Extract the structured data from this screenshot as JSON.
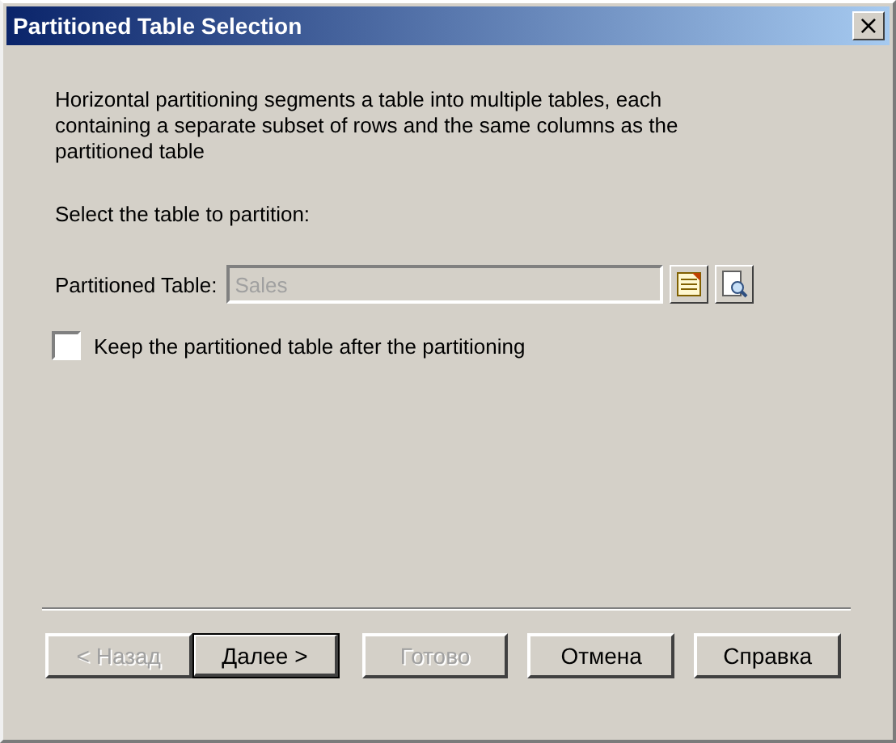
{
  "window": {
    "title": "Partitioned Table Selection",
    "close": "×"
  },
  "description": "Horizontal partitioning segments a table into multiple tables, each containing a separate subset of rows and the same columns as the partitioned table",
  "prompt": "Select the table to partition:",
  "table_field": {
    "label": "Partitioned Table:",
    "value": "Sales",
    "disabled": true
  },
  "keep_checkbox": {
    "label": "Keep the partitioned table after the partitioning",
    "checked": false
  },
  "buttons": [
    {
      "label": "< Назад",
      "disabled": true,
      "default": false
    },
    {
      "label": "Далее >",
      "disabled": false,
      "default": true
    },
    {
      "label": "Готово",
      "disabled": true,
      "default": false
    },
    {
      "label": "Отмена",
      "disabled": false,
      "default": false
    },
    {
      "label": "Справка",
      "disabled": false,
      "default": false
    }
  ]
}
